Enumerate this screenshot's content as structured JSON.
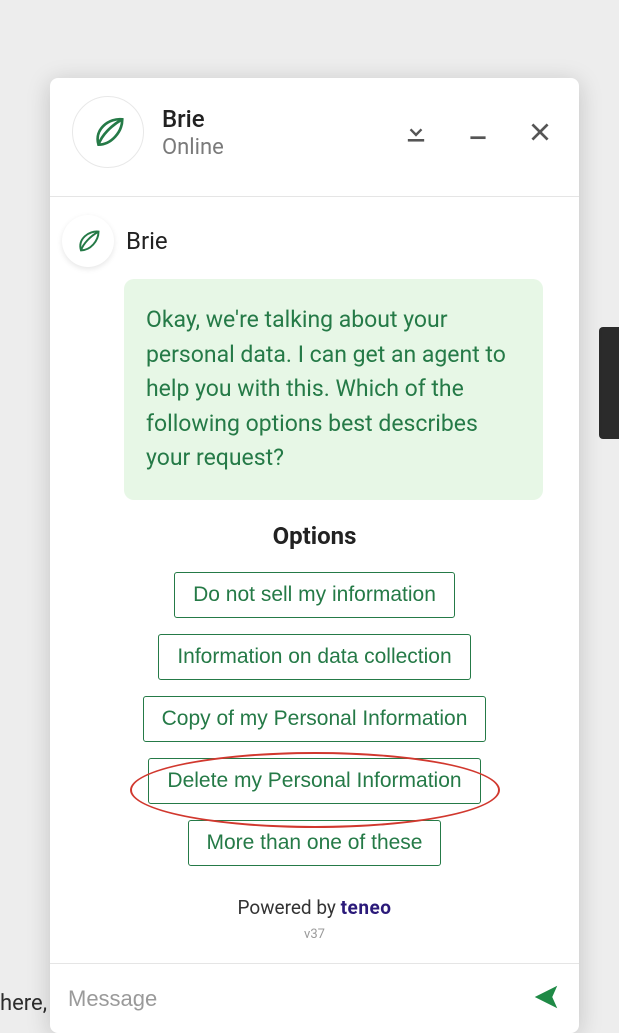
{
  "header": {
    "bot_name": "Brie",
    "status": "Online"
  },
  "conversation": {
    "bot_name": "Brie",
    "message": "Okay, we're talking about your personal data. I can get an agent to help you with this. Which of the following options best describes your request?"
  },
  "options": {
    "title": "Options",
    "items": [
      "Do not sell my information",
      "Information on data collection",
      "Copy of my Personal Information",
      "Delete my Personal Information",
      "More than one of these"
    ]
  },
  "footer": {
    "placeholder": "Message",
    "powered_by_prefix": "Powered by ",
    "powered_by_brand": "teneo",
    "version": "v37"
  },
  "background_text": "here, anytime."
}
